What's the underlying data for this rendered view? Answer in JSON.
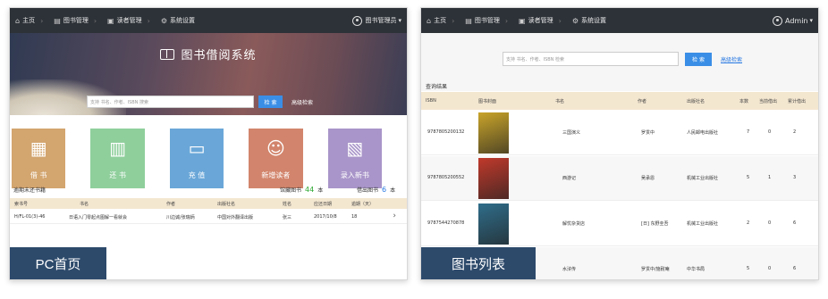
{
  "pc": {
    "nav": {
      "home": "主页",
      "books": "图书管理",
      "readers": "读者管理",
      "settings": "系统设置",
      "user": "图书管理员"
    },
    "hero": {
      "title": "图书借阅系统",
      "search_placeholder": "支持 书名、作者、ISBN 搜索",
      "search_button": "检 索",
      "advanced": "高级检索"
    },
    "tiles": [
      {
        "label": "借 书",
        "color": "#d3a56f",
        "icon": "borrow-icon"
      },
      {
        "label": "还 书",
        "color": "#8fcf9c",
        "icon": "return-icon"
      },
      {
        "label": "充 值",
        "color": "#6aa7d8",
        "icon": "card-icon"
      },
      {
        "label": "新增读者",
        "color": "#d2856c",
        "icon": "add-user-icon"
      },
      {
        "label": "录入新书",
        "color": "#a995c9",
        "icon": "add-book-icon"
      }
    ],
    "stats": {
      "overdue_label": "逾期未还书籍",
      "collection_label": "馆藏图书",
      "collection_count": "44",
      "collection_unit": "本",
      "borrowable_label": "借出图书",
      "borrowable_count": "6",
      "borrowable_unit": "本"
    },
    "table": {
      "headers": [
        "索书号",
        "书名",
        "作者",
        "出版社名",
        "姓名",
        "应还日期",
        "逾期（天）"
      ],
      "rows": [
        [
          "H/FL-01(3)-46",
          "日语入门零起点图解一看就会",
          "川边诚/张瑞炳",
          "中国对外翻译出版",
          "张三",
          "2017/10/8",
          "18"
        ]
      ]
    },
    "badge": "PC首页"
  },
  "list": {
    "nav": {
      "home": "主页",
      "books": "图书管理",
      "readers": "读者管理",
      "settings": "系统设置",
      "user": "Admin"
    },
    "search_placeholder": "支持 书名、作者、ISBN 检索",
    "search_button": "检 索",
    "advanced": "高级检索",
    "caption": "查询结果",
    "headers": [
      "ISBN",
      "图书封面",
      "书名",
      "作者",
      "出版社名",
      "本数",
      "当前借出",
      "累计借出"
    ],
    "rows": [
      {
        "isbn": "9787805200132",
        "title": "三国演义",
        "author": "罗贯中",
        "publisher": "人民邮电出版社",
        "count": "7",
        "current": "0",
        "total": "2",
        "cover": "#c9a42a"
      },
      {
        "isbn": "9787805200552",
        "title": "西游记",
        "author": "吴承恩",
        "publisher": "机械工业出版社",
        "count": "5",
        "current": "1",
        "total": "3",
        "cover": "#c0392b"
      },
      {
        "isbn": "9787544270878",
        "title": "解忧杂货店",
        "author": "[日] 东野圭吾",
        "publisher": "机械工业出版社",
        "count": "2",
        "current": "0",
        "total": "6",
        "cover": "#2f6d8a"
      },
      {
        "isbn": "",
        "title": "水浒传",
        "author": "罗贯中/施耐庵",
        "publisher": "中华书局",
        "count": "5",
        "current": "0",
        "total": "6",
        "cover": "#8e2b2b"
      }
    ],
    "badge": "图书列表"
  }
}
